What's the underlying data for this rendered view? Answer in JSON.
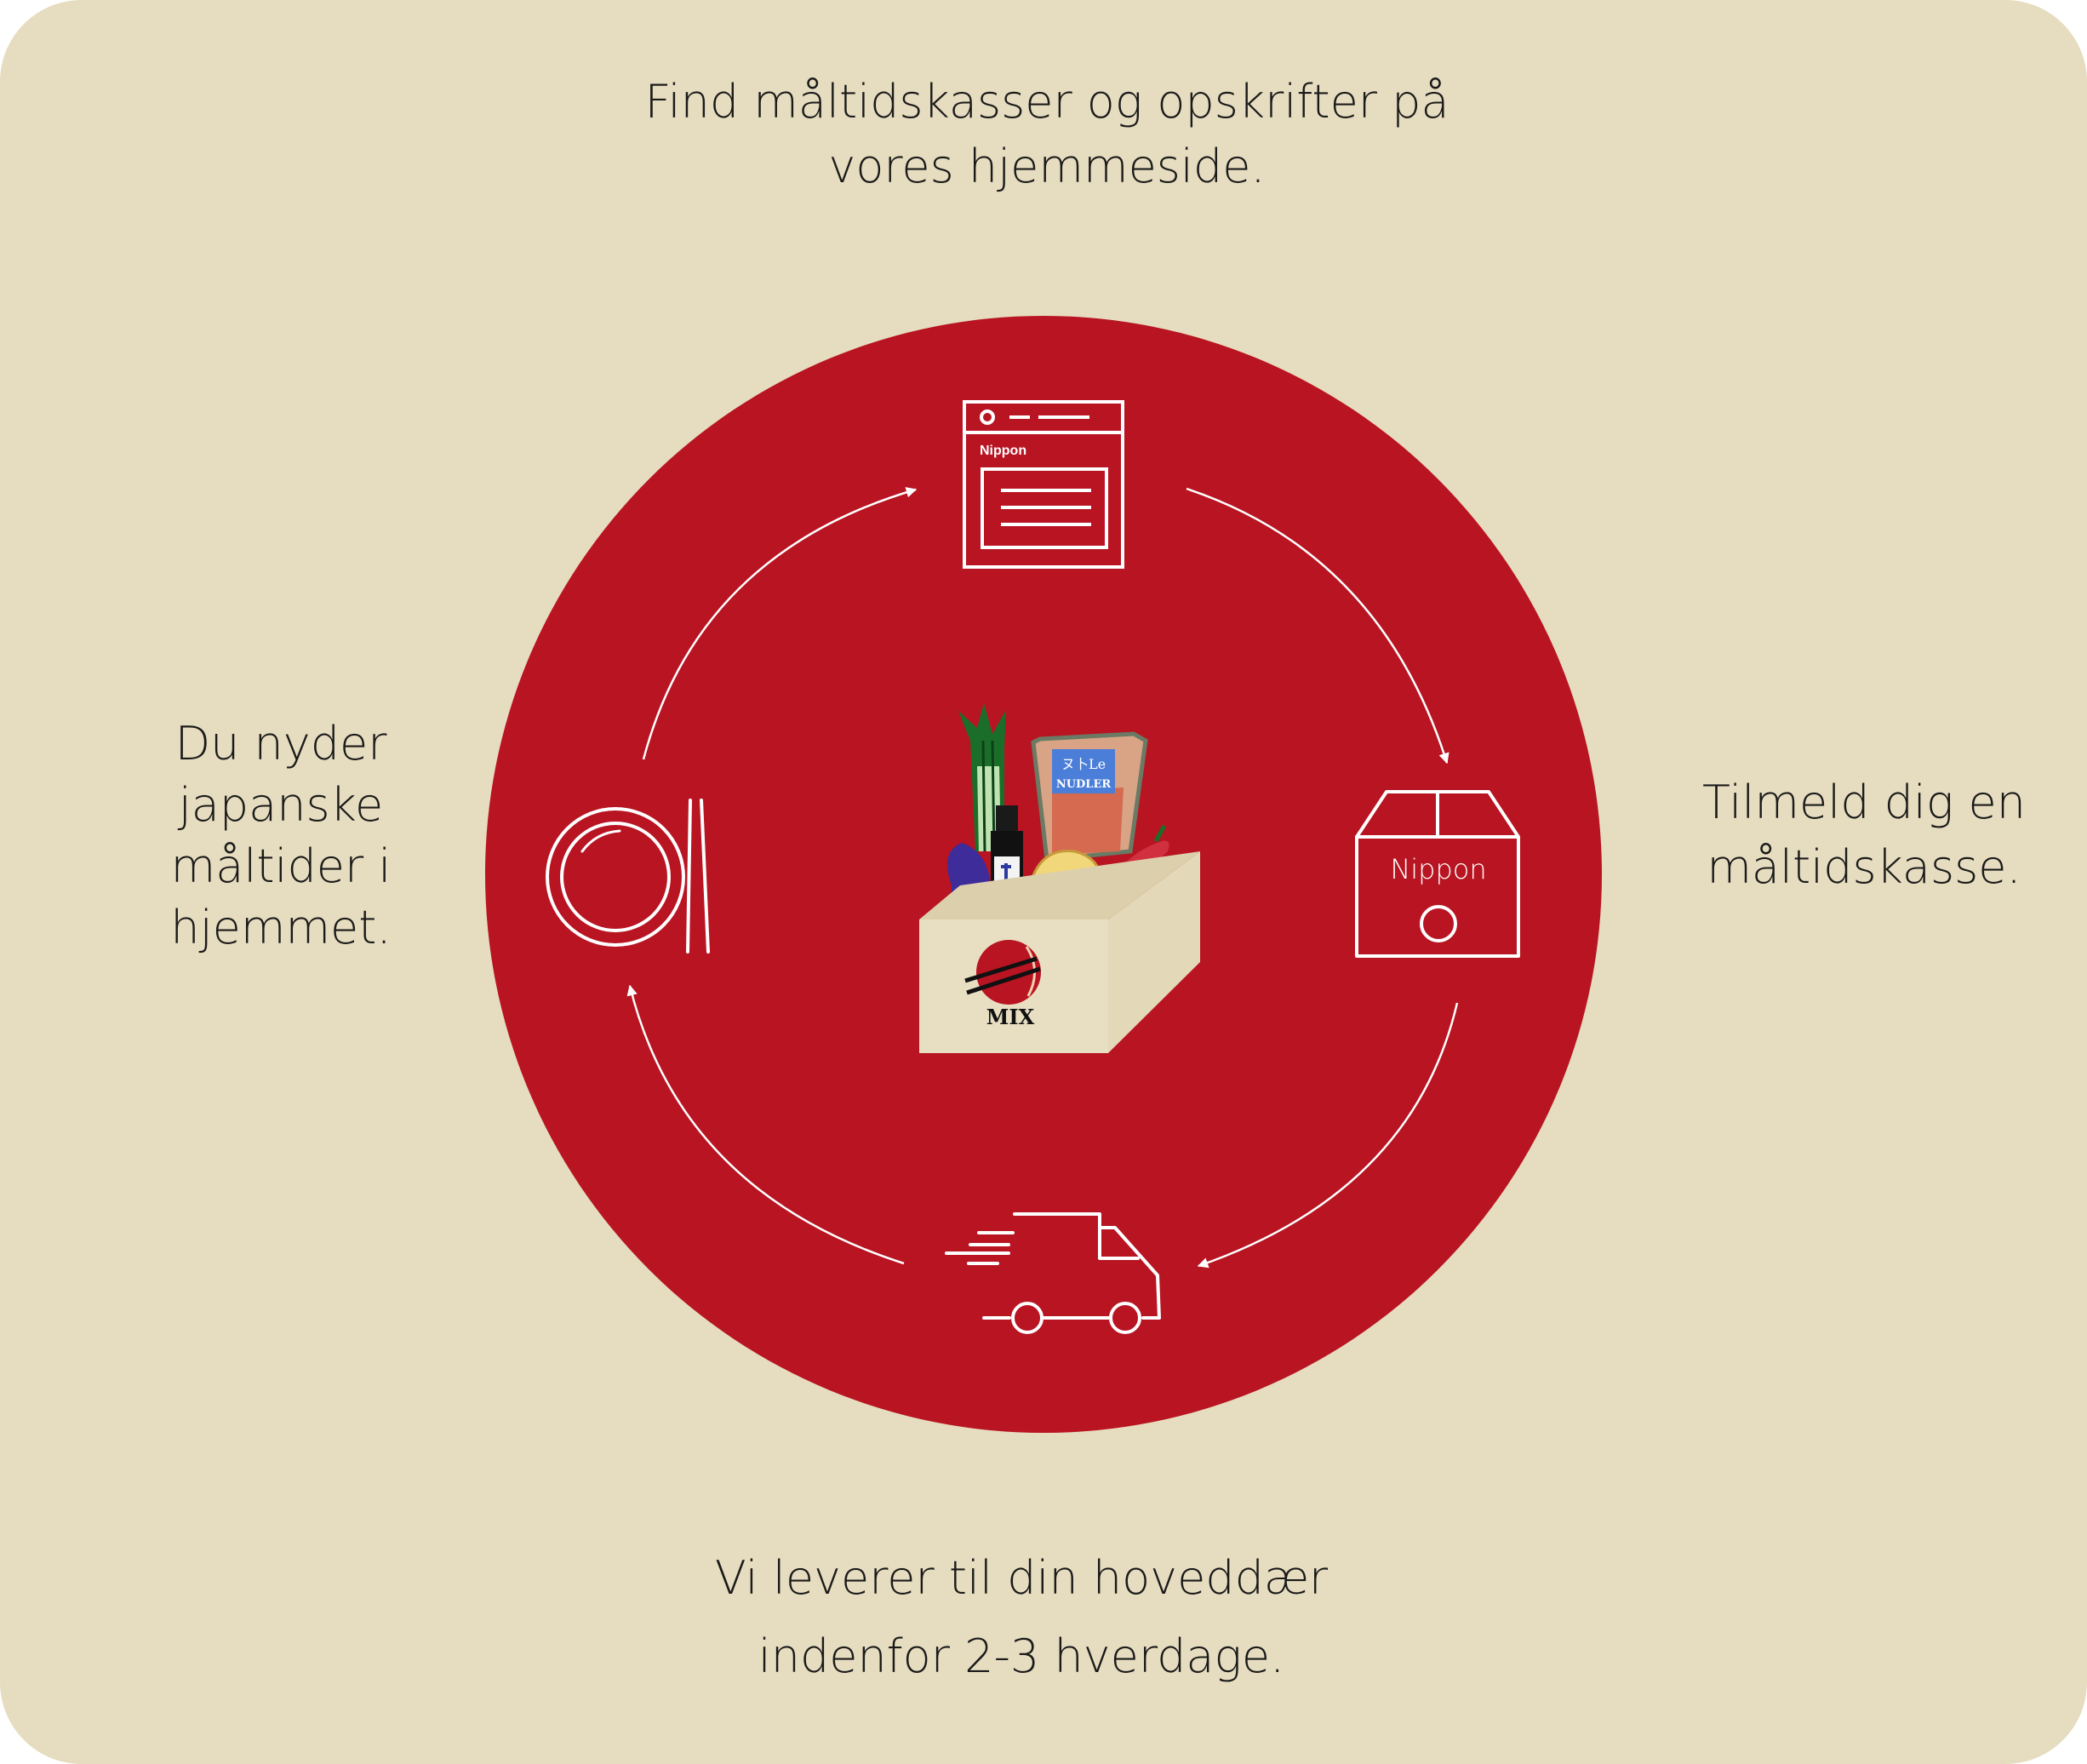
{
  "steps": {
    "website": {
      "text": "Find måltidskasser og opskrifter på\nvores hjemmeside.",
      "icon": "browser-window-icon",
      "browser_label": "Nippon"
    },
    "signup": {
      "text": "Tilmeld dig en\nmåltidskasse.",
      "icon": "shipping-box-icon",
      "box_label": "Nippon"
    },
    "delivery": {
      "text": "Vi leverer til din hoveddær\nindenfor 2-3 hverdage.",
      "icon": "delivery-truck-icon"
    },
    "enjoy": {
      "text": "Du nyder\njapanske\nmåltider i\nhjemmet.",
      "icon": "plate-chopsticks-icon"
    }
  },
  "center_box": {
    "icon": "meal-kit-box-illustration",
    "box_label": "MIX",
    "noodle_pack_label": "NUDLER",
    "noodle_pack_glyphs": "ヌ卜Le"
  },
  "colors": {
    "background": "#e6dcbf",
    "circle": "#b81422",
    "line": "#ffffff",
    "text": "#1a1a1a"
  }
}
